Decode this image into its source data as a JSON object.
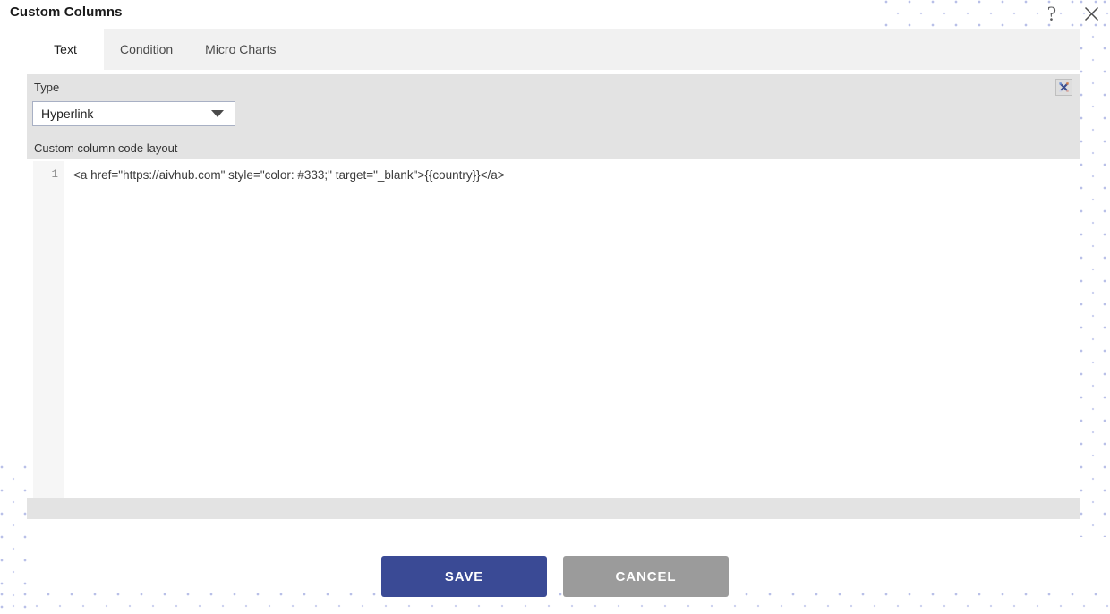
{
  "header": {
    "title": "Custom Columns",
    "help_icon": "question-mark-icon",
    "help_glyph": "?",
    "close_icon": "close-icon"
  },
  "tabs": [
    {
      "label": "Text",
      "active": true
    },
    {
      "label": "Condition",
      "active": false
    },
    {
      "label": "Micro Charts",
      "active": false
    }
  ],
  "options_panel": {
    "type_label": "Type",
    "type_select": {
      "value": "Hyperlink",
      "options": [
        "Hyperlink"
      ],
      "arrow_icon": "chevron-down-icon"
    },
    "code_layout_label": "Custom column code layout",
    "close_icon": "broken-image-icon"
  },
  "editor": {
    "lines": [
      {
        "number": "1",
        "text": "<a href=\"https://aivhub.com\" style=\"color: #333;\" target=\"_blank\">{{country}}</a>"
      }
    ]
  },
  "actions": {
    "save_label": "SAVE",
    "cancel_label": "CANCEL"
  },
  "colors": {
    "save_button": "#3a4a95",
    "cancel_button": "#9b9b9b",
    "panel_background": "#e3e3e3",
    "tab_bar_background": "#f1f1f1",
    "dot_pattern": "#b9c0e8"
  }
}
